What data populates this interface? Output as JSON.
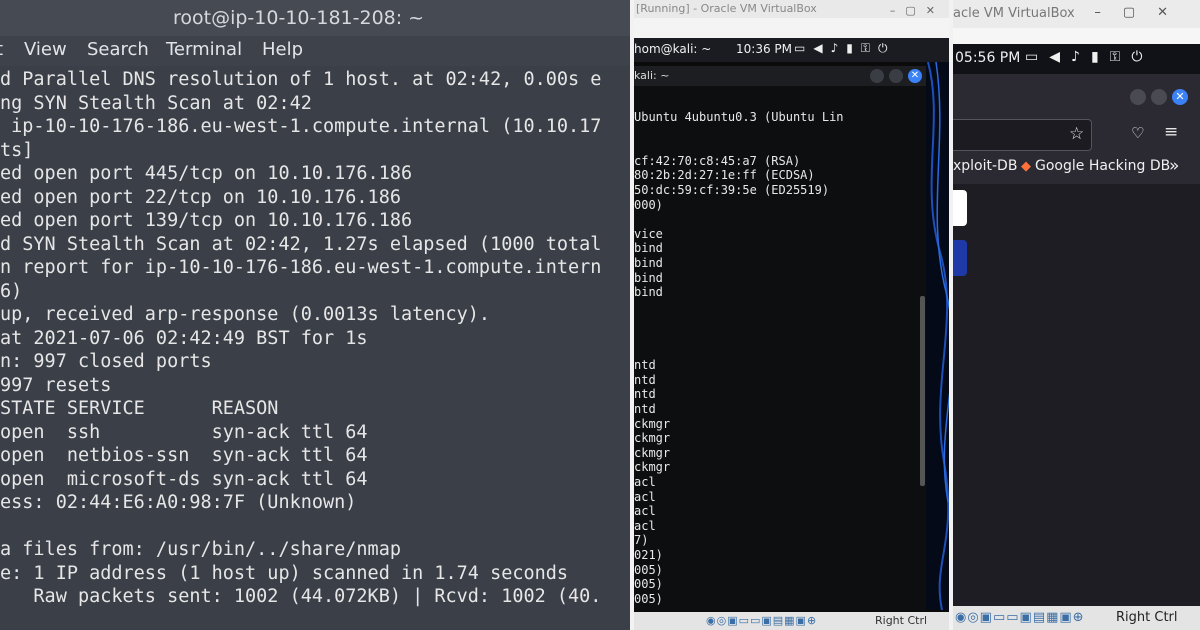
{
  "terminal_main": {
    "title": "root@ip-10-10-181-208: ~",
    "menu": [
      "View",
      "Search",
      "Terminal",
      "Help"
    ],
    "lines": [
      "d Parallel DNS resolution of 1 host. at 02:42, 0.00s e",
      "ng SYN Stealth Scan at 02:42",
      " ip-10-10-176-186.eu-west-1.compute.internal (10.10.17",
      "ts]",
      "ed open port 445/tcp on 10.10.176.186",
      "ed open port 22/tcp on 10.10.176.186",
      "ed open port 139/tcp on 10.10.176.186",
      "d SYN Stealth Scan at 02:42, 1.27s elapsed (1000 total",
      "n report for ip-10-10-176-186.eu-west-1.compute.intern",
      "6)",
      "up, received arp-response (0.0013s latency).",
      "at 2021-07-06 02:42:49 BST for 1s",
      "n: 997 closed ports",
      "997 resets",
      "STATE SERVICE      REASON",
      "open  ssh          syn-ack ttl 64",
      "open  netbios-ssn  syn-ack ttl 64",
      "open  microsoft-ds syn-ack ttl 64",
      "ess: 02:44:E6:A0:98:7F (Unknown)",
      "",
      "a files from: /usr/bin/../share/nmap",
      "e: 1 IP address (1 host up) scanned in 1.74 seconds",
      "   Raw packets sent: 1002 (44.072KB) | Rcvd: 1002 (40."
    ],
    "prompt_host": "10-10-181-208",
    "prompt_symbol": ":~#"
  },
  "vm_middle": {
    "window_title": "[Running] - Oracle VM VirtualBox",
    "tab_label": "hom@kali: ~",
    "clock": "10:36 PM",
    "terminal_title": "kali: ~",
    "status_right": "Right Ctrl",
    "lines": [
      "Ubuntu 4ubuntu0.3 (Ubuntu Lin",
      "",
      "",
      "cf:42:70:c8:45:a7 (RSA)",
      "80:2b:2d:27:1e:ff (ECDSA)",
      "50:dc:59:cf:39:5e (ED25519)",
      "000)",
      "",
      "vice",
      "bind",
      "bind",
      "bind",
      "bind",
      "",
      "",
      "",
      "",
      "ntd",
      "ntd",
      "ntd",
      "ntd",
      "ckmgr",
      "ckmgr",
      "ckmgr",
      "ckmgr",
      "acl",
      "acl",
      "acl",
      "acl",
      "7)",
      "021)",
      "005)",
      "005)",
      "005)"
    ]
  },
  "vm_right": {
    "window_title": "acle VM VirtualBox",
    "clock": "05:56 PM",
    "bookmarks": [
      "xploit-DB",
      "Google Hacking DB"
    ],
    "status_right": "Right Ctrl"
  },
  "colors": {
    "terminal_bg": "#3a3f48",
    "prompt_green": "#7ee787",
    "firefox_close_blue": "#3b82f6"
  }
}
